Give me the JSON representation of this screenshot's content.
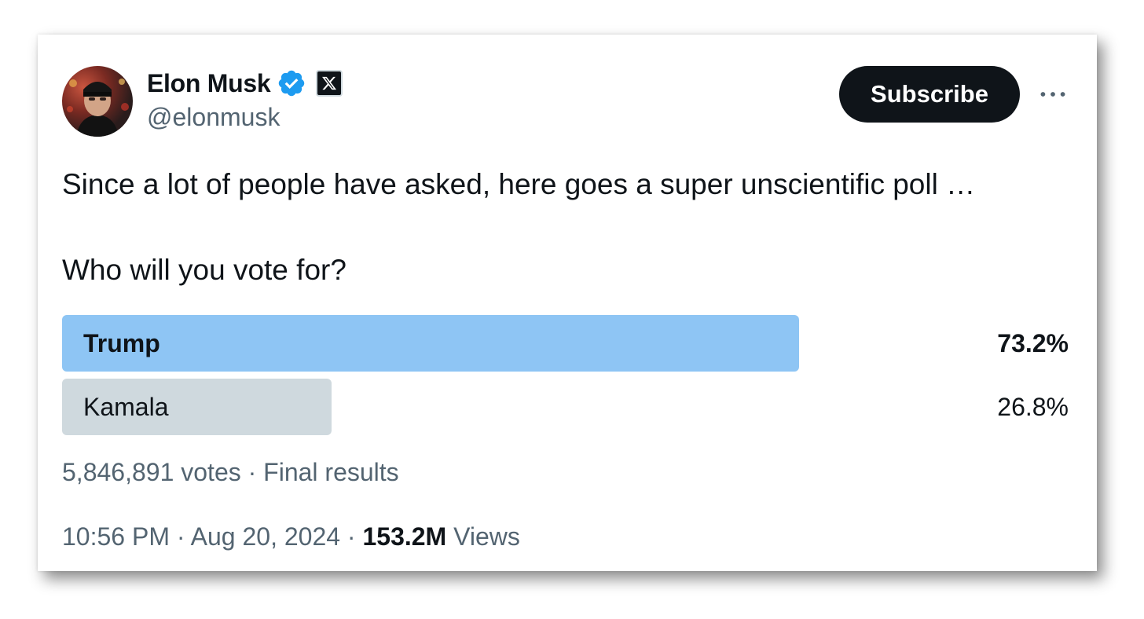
{
  "author": {
    "display_name": "Elon Musk",
    "handle": "@elonmusk",
    "avatar_icon": "profile-photo",
    "verified_icon": "verified-badge-icon",
    "affiliate_icon": "x-logo-icon"
  },
  "actions": {
    "subscribe_label": "Subscribe",
    "more_icon": "more-horizontal-icon"
  },
  "tweet": {
    "text": "Since a lot of people have asked, here goes a super unscientific poll …",
    "question": "Who will you vote for?"
  },
  "poll": {
    "options": [
      {
        "label": "Trump",
        "percent_text": "73.2%",
        "share": 0.732,
        "winner": true
      },
      {
        "label": "Kamala",
        "percent_text": "26.8%",
        "share": 0.268,
        "winner": false
      }
    ],
    "votes": "5,846,891 votes",
    "status": "Final results",
    "separator": "·"
  },
  "footer": {
    "time": "10:56 PM",
    "date": "Aug 20, 2024",
    "views_count": "153.2M",
    "views_label": "Views",
    "separator": "·"
  },
  "colors": {
    "winner_bar": "#8ec5f4",
    "loser_bar": "#cfd9de",
    "verified_blue": "#1d9bf0",
    "text_primary": "#0f1419",
    "text_secondary": "#536471",
    "button_bg": "#0f1419"
  }
}
